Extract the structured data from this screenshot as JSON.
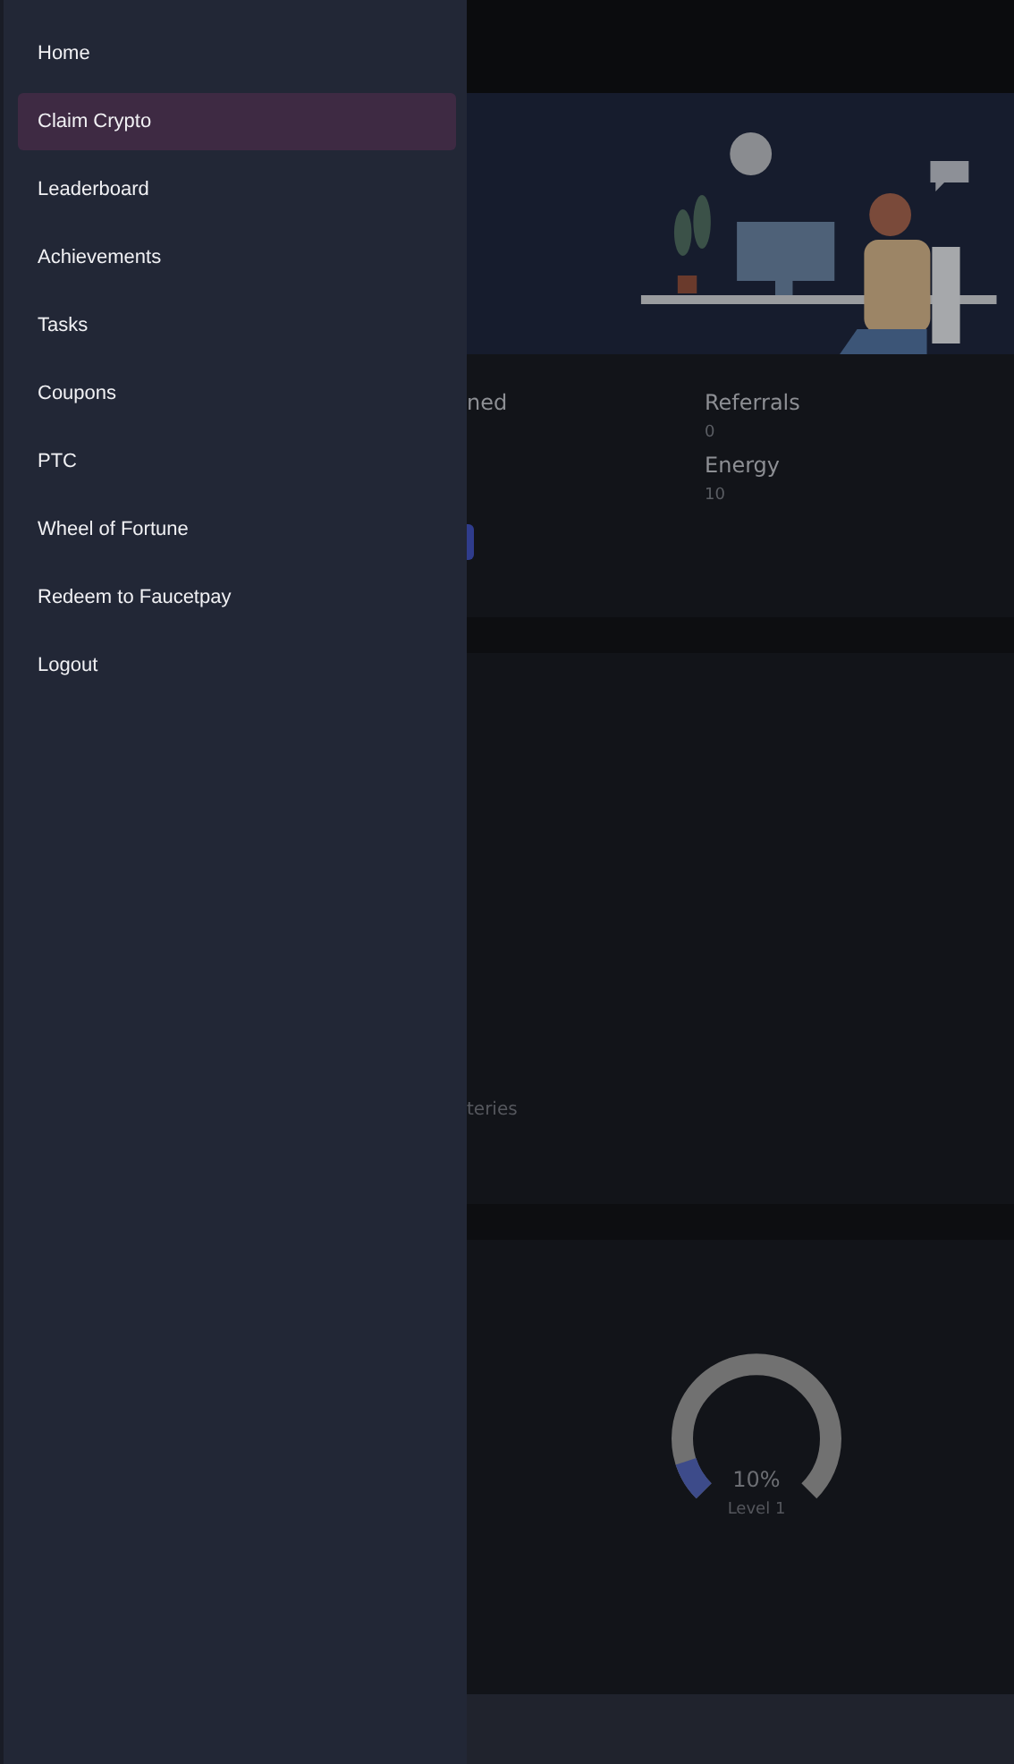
{
  "drawer": {
    "items": [
      {
        "label": "Home",
        "selected": false
      },
      {
        "label": "Claim Crypto",
        "selected": true
      },
      {
        "label": "Leaderboard",
        "selected": false
      },
      {
        "label": "Achievements",
        "selected": false
      },
      {
        "label": "Tasks",
        "selected": false
      },
      {
        "label": "Coupons",
        "selected": false
      },
      {
        "label": "PTC",
        "selected": false
      },
      {
        "label": "Wheel of Fortune",
        "selected": false
      },
      {
        "label": "Redeem to Faucetpay",
        "selected": false
      },
      {
        "label": "Logout",
        "selected": false
      }
    ]
  },
  "stats": {
    "column_1": {
      "heading": "ned"
    },
    "referrals": {
      "label": "Referrals",
      "value": "0"
    },
    "energy": {
      "label": "Energy",
      "value": "10"
    }
  },
  "card": {
    "text": "teries"
  },
  "level_card": {
    "gauge": {
      "percent": "10%",
      "label": "Level 1"
    }
  }
}
